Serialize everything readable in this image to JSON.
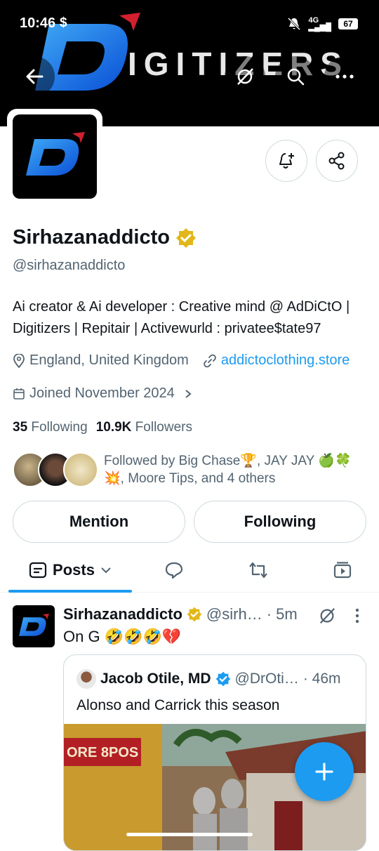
{
  "status_bar": {
    "time": "10:46",
    "dollar_icon": "$",
    "network": "4G",
    "battery": "67"
  },
  "banner": {
    "wordmark": "IGITIZERS"
  },
  "profile": {
    "display_name": "Sirhazanaddicto",
    "handle": "@sirhazanaddicto",
    "bio_line1": "Ai creator & Ai developer : Creative mind @ AdDiCtO |",
    "bio_line2": "Digitizers | Repitair | Activewurld : privatee$tate97",
    "location": "England, United Kingdom",
    "website": "addictoclothing.store",
    "joined": "Joined November 2024",
    "following_count": "35",
    "following_label": "Following",
    "followers_count": "10.9K",
    "followers_label": "Followers",
    "followed_by_line1": "Followed by Big Chase🏆, JAY JAY 🍏🍀",
    "followed_by_line2": "💥, Moore Tips, and 4 others"
  },
  "actions": {
    "mention": "Mention",
    "following": "Following"
  },
  "tabs": {
    "posts": "Posts"
  },
  "tweet": {
    "author": "Sirhazanaddicto",
    "handle": "@sirh…",
    "time": "· 5m",
    "text": "On G 🤣🤣🤣💔",
    "quote": {
      "author": "Jacob Otile, MD",
      "handle": "@DrOti…",
      "time": "· 46m",
      "text": "Alonso and Carrick this season",
      "sign_text": "ORE 8POS"
    }
  },
  "colors": {
    "accent": "#1d9bf0",
    "verified_gold": "#e2b719",
    "text": "#0f1419",
    "secondary": "#536471"
  }
}
